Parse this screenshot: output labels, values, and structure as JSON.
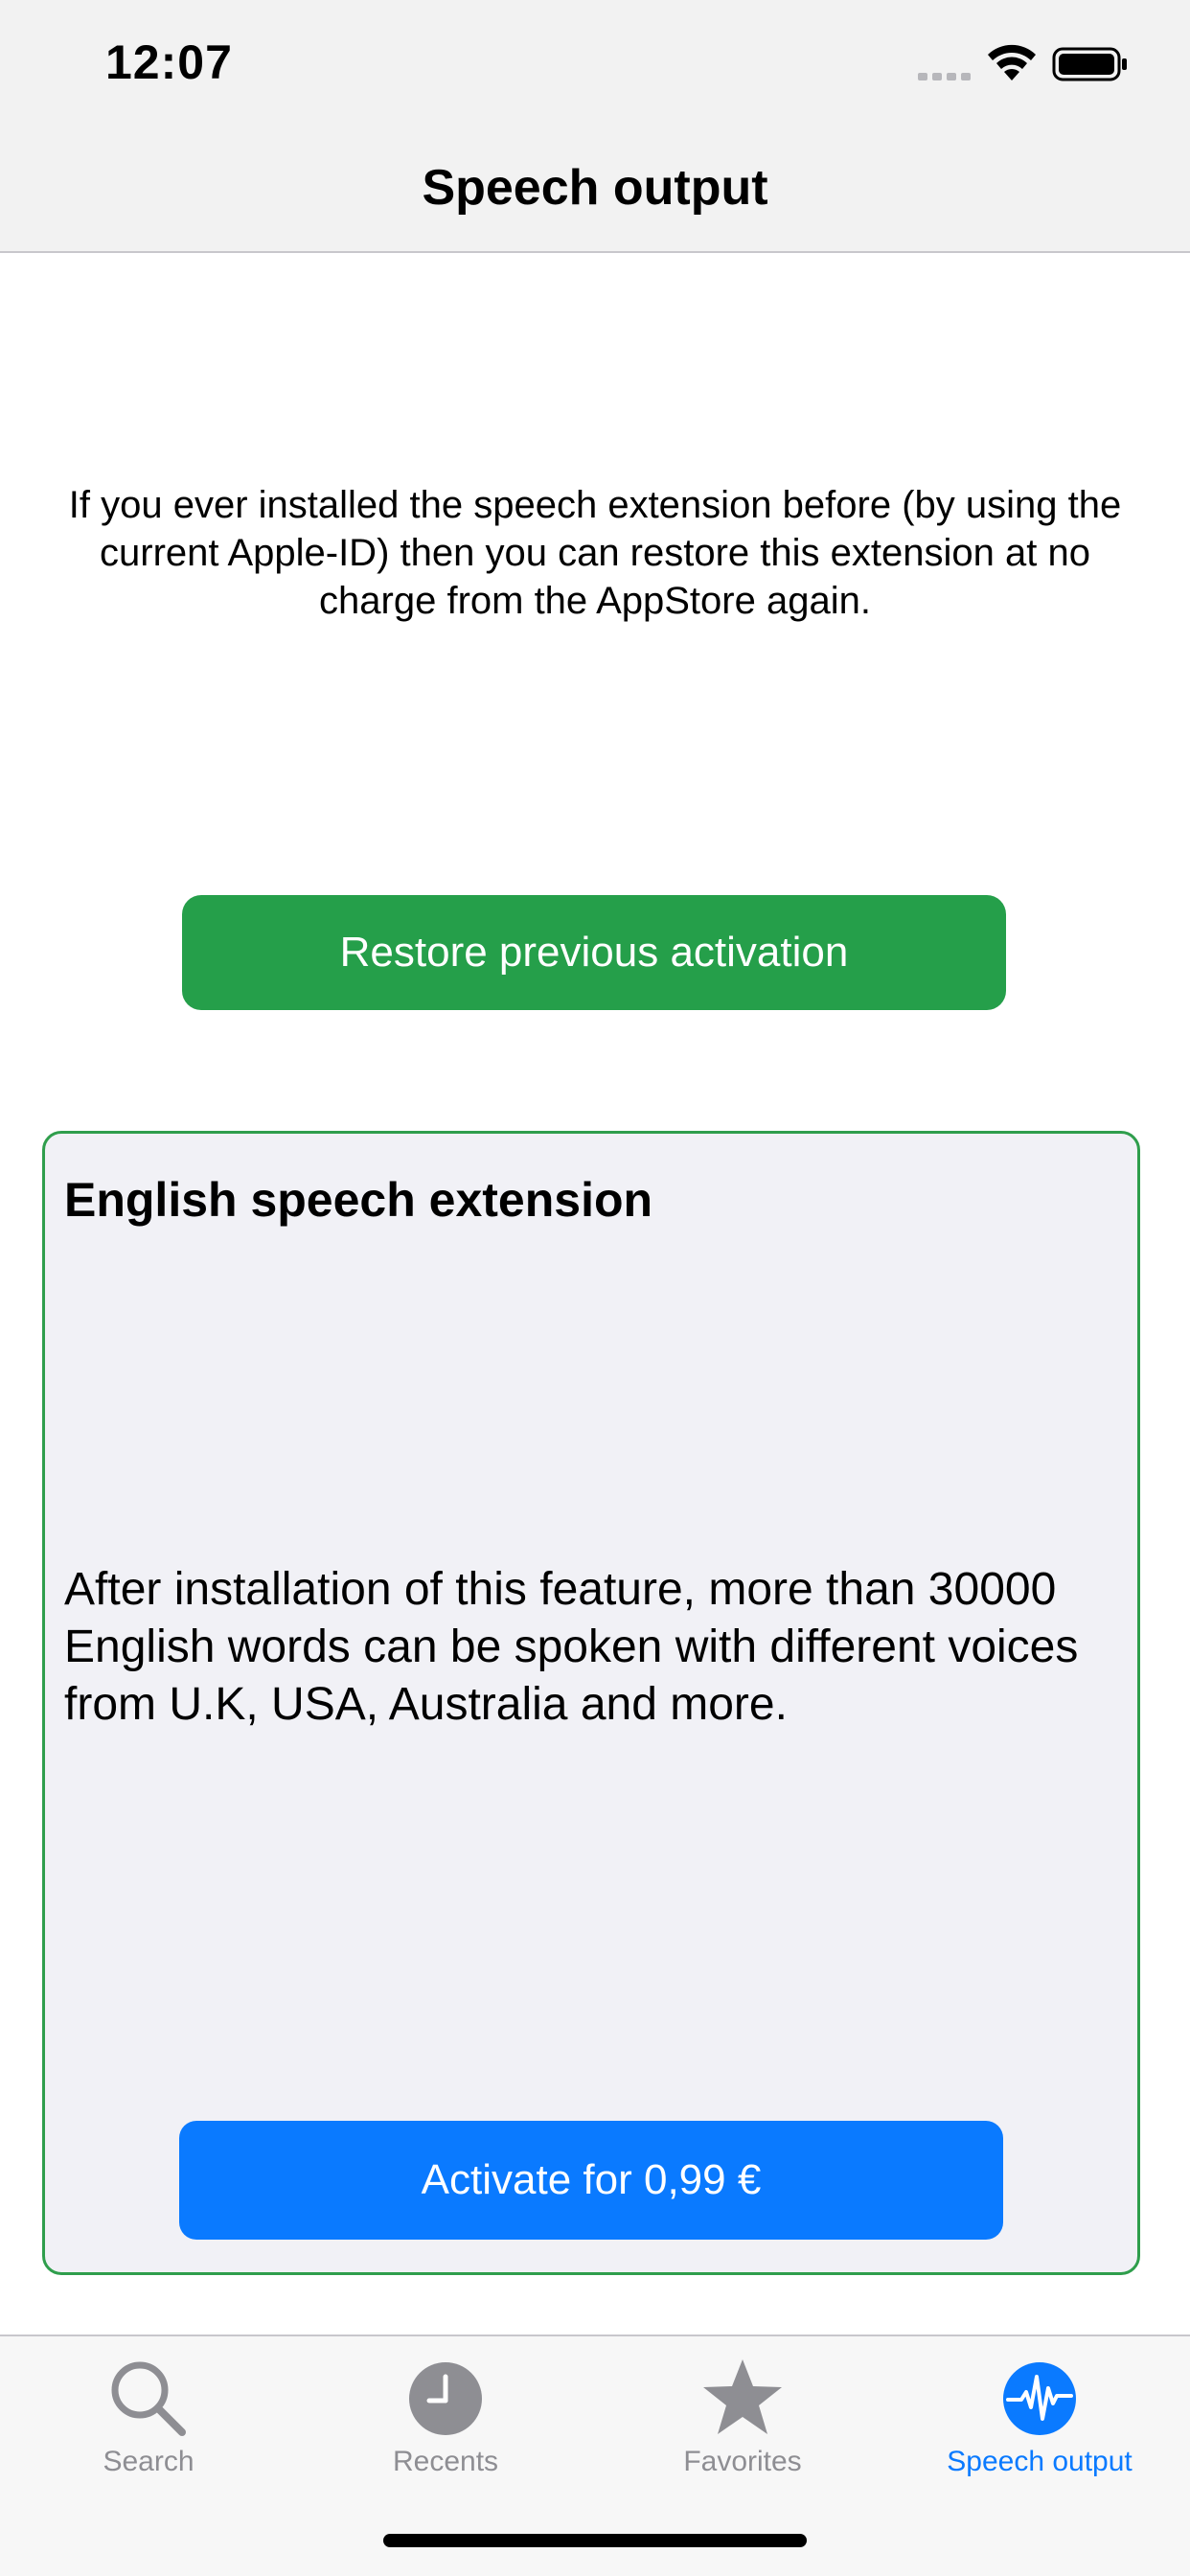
{
  "status_bar": {
    "time": "12:07"
  },
  "nav": {
    "title": "Speech output"
  },
  "info": {
    "text": "If you ever installed the speech extension before (by using the current Apple-ID) then you can restore this extension at no charge from the AppStore again."
  },
  "restore_button": {
    "label": "Restore previous activation"
  },
  "extension": {
    "title": "English speech extension",
    "description": "After installation of this feature, more than 30000 English words can be spoken with different voices from U.K, USA, Australia and more.",
    "activate_label": "Activate for 0,99 €"
  },
  "tabs": [
    {
      "label": "Search",
      "icon": "magnifier-icon"
    },
    {
      "label": "Recents",
      "icon": "clock-icon"
    },
    {
      "label": "Favorites",
      "icon": "star-icon"
    },
    {
      "label": "Speech output",
      "icon": "waveform-icon"
    }
  ],
  "colors": {
    "restore_green": "#259f4a",
    "card_border_green": "#2f9e4c",
    "accent_blue": "#0a7aff",
    "inactive_gray": "#8e8e93"
  }
}
